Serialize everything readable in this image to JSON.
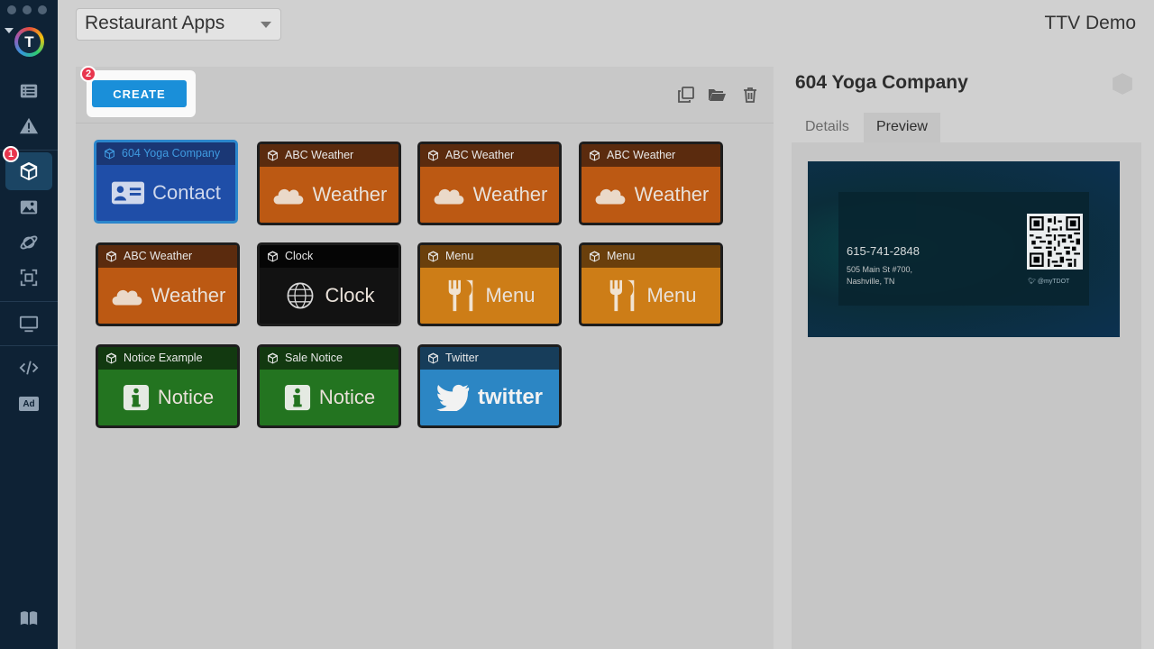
{
  "sidebar": {
    "logo_letter": "T",
    "steps": {
      "first": "1",
      "second": "2"
    },
    "items": [
      {
        "name": "list"
      },
      {
        "name": "alerts"
      },
      {
        "name": "apps"
      },
      {
        "name": "images"
      },
      {
        "name": "planet"
      },
      {
        "name": "screenshot"
      },
      {
        "name": "displays"
      },
      {
        "name": "code"
      },
      {
        "name": "ads",
        "label": "Ad"
      },
      {
        "name": "docs"
      }
    ]
  },
  "header": {
    "app_group": "Restaurant Apps",
    "account": "TTV Demo"
  },
  "toolbar": {
    "create_label": "CREATE"
  },
  "tiles": [
    {
      "title": "604 Yoga Company",
      "body": "Contact",
      "kind": "contact"
    },
    {
      "title": "ABC Weather",
      "body": "Weather",
      "kind": "weather"
    },
    {
      "title": "ABC Weather",
      "body": "Weather",
      "kind": "weather"
    },
    {
      "title": "ABC Weather",
      "body": "Weather",
      "kind": "weather"
    },
    {
      "title": "ABC Weather",
      "body": "Weather",
      "kind": "weather"
    },
    {
      "title": "Clock",
      "body": "Clock",
      "kind": "clock"
    },
    {
      "title": "Menu",
      "body": "Menu",
      "kind": "menu"
    },
    {
      "title": "Menu",
      "body": "Menu",
      "kind": "menu"
    },
    {
      "title": "Notice Example",
      "body": "Notice",
      "kind": "notice"
    },
    {
      "title": "Sale Notice",
      "body": "Notice",
      "kind": "notice"
    },
    {
      "title": "Twitter",
      "body": "twitter",
      "kind": "twitter"
    }
  ],
  "details": {
    "title": "604 Yoga Company",
    "tabs": [
      "Details",
      "Preview"
    ],
    "active_tab": "Preview",
    "preview": {
      "phone": "615-741-2848",
      "address_line1": "505 Main St #700,",
      "address_line2": "Nashville, TN",
      "handle": "@myTDOT"
    }
  }
}
